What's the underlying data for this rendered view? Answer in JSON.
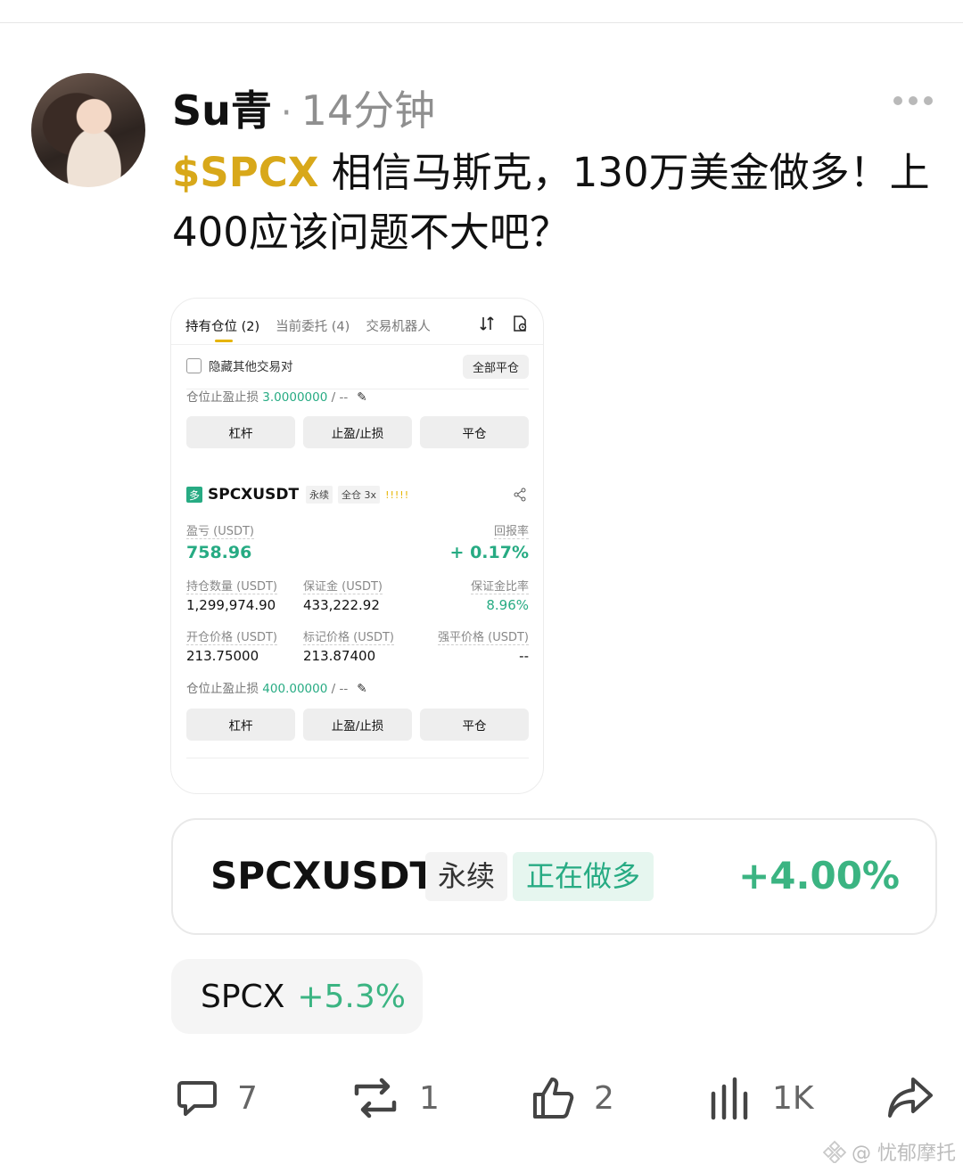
{
  "post": {
    "username": "Su青",
    "separator": "·",
    "time_ago": "14分钟",
    "ticker": "$SPCX",
    "body": " 相信马斯克，130万美金做多！上400应该问题不大吧？"
  },
  "screenshot": {
    "tabs": [
      "持有仓位 (2)",
      "当前委托 (4)",
      "交易机器人"
    ],
    "hide_other_pairs": "隐藏其他交易对",
    "close_all": "全部平仓",
    "tpsl_partial": {
      "label": "仓位止盈止损 ",
      "value": "3.0000000",
      "suffix": " / --"
    },
    "buttons": [
      "杠杆",
      "止盈/止损",
      "平仓"
    ],
    "position": {
      "side_badge": "多",
      "symbol": "SPCXUSDT",
      "type_tag": "永续",
      "margin_tag": "全仓 3x",
      "strength": "!!!!!",
      "pnl_label": "盈亏 (USDT)",
      "pnl_value": "758.96",
      "roe_label": "回报率",
      "roe_value": "+ 0.17%",
      "size_label": "持仓数量 (USDT)",
      "size_value": "1,299,974.90",
      "margin_label": "保证金 (USDT)",
      "margin_value": "433,222.92",
      "margin_ratio_label": "保证金比率",
      "margin_ratio_value": "8.96%",
      "entry_label": "开仓价格 (USDT)",
      "entry_value": "213.75000",
      "mark_label": "标记价格 (USDT)",
      "mark_value": "213.87400",
      "liq_label": "强平价格 (USDT)",
      "liq_value": "--",
      "tpsl": {
        "label": "仓位止盈止损 ",
        "value": "400.00000",
        "suffix": " / --"
      }
    }
  },
  "position_card": {
    "symbol": "SPCXUSDT",
    "type_tag": "永续",
    "status": "正在做多",
    "change": "+4.00%"
  },
  "stock_chip": {
    "symbol": "SPCX",
    "change": "+5.3%"
  },
  "actions": {
    "comments": "7",
    "reposts": "1",
    "likes": "2",
    "views": "1K"
  },
  "watermark": "@ 忧郁摩托",
  "colors": {
    "ticker_gold": "#d8a81a",
    "profit_green": "#27ab83",
    "positive_green": "#3bb482"
  }
}
